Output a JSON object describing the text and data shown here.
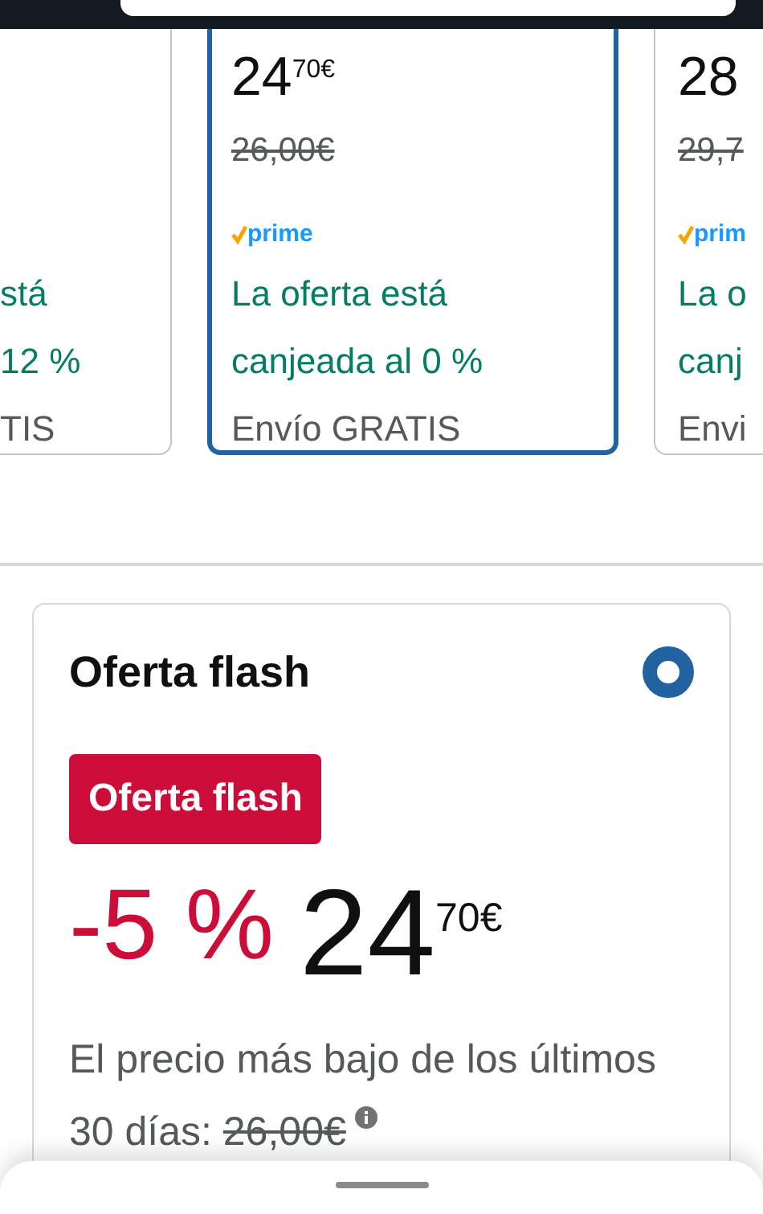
{
  "offers": [
    {
      "selected": false,
      "deal_lines": [
        "stá",
        "12 %"
      ],
      "shipping": "TIS"
    },
    {
      "selected": true,
      "price_whole": "24",
      "price_fraction": "70€",
      "list_price": "26,00€",
      "prime_label": "prime",
      "deal_lines": [
        "La oferta está",
        "canjeada al 0 %"
      ],
      "shipping": "Envío GRATIS"
    },
    {
      "selected": false,
      "price_whole": "28",
      "list_price": "29,7",
      "prime_label": "prim",
      "deal_lines": [
        "La o",
        "canj"
      ],
      "shipping": "Envi"
    }
  ],
  "flash_offer": {
    "title": "Oferta flash",
    "selected": true,
    "badge": "Oferta flash",
    "discount": "-5 %",
    "price_whole": "24",
    "price_fraction": "70€",
    "note": "El precio más bajo de los últimos 30 días:",
    "note_price": "26,00€"
  }
}
